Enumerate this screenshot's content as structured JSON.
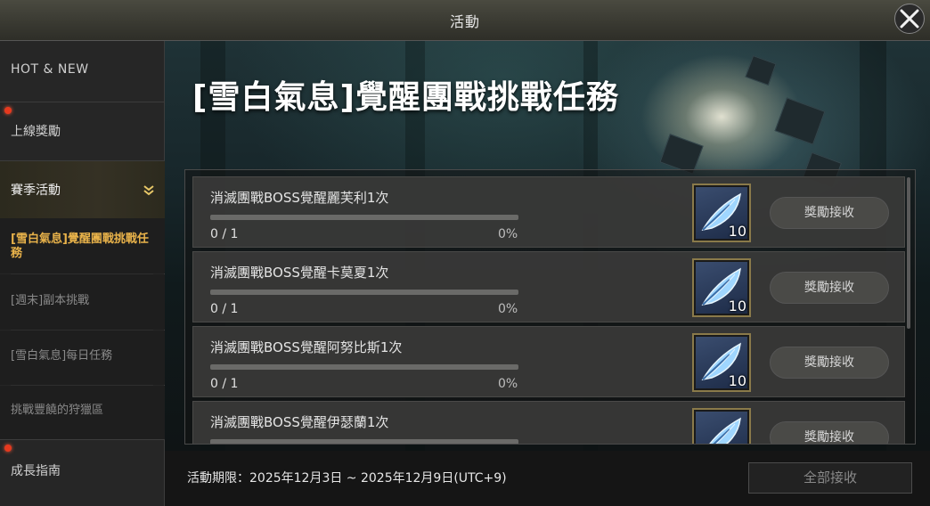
{
  "window": {
    "title": "活動"
  },
  "sidebar": {
    "items": [
      {
        "label": "HOT & NEW",
        "has_dot": false
      },
      {
        "label": "上線獎勵",
        "has_dot": true
      },
      {
        "label": "賽季活動",
        "has_dot": false,
        "expanded": true
      },
      {
        "label": "成長指南",
        "has_dot": true
      }
    ],
    "sub_items": [
      {
        "label": "[雪白氣息]覺醒團戰挑戰任務",
        "selected": true
      },
      {
        "label": "[週末]副本挑戰",
        "selected": false
      },
      {
        "label": "[雪白氣息]每日任務",
        "selected": false
      },
      {
        "label": "挑戰豐饒的狩獵區",
        "selected": false
      }
    ]
  },
  "main": {
    "event_title": "[雪白氣息]覺醒團戰挑戰任務",
    "tasks": [
      {
        "name": "消滅團戰BOSS覺醒麗芙利1次",
        "count": "0 / 1",
        "percent": "0%",
        "progress": 0,
        "reward_icon": "blue-feather-icon",
        "reward_qty": "10",
        "claim_label": "獎勵接收"
      },
      {
        "name": "消滅團戰BOSS覺醒卡莫夏1次",
        "count": "0 / 1",
        "percent": "0%",
        "progress": 0,
        "reward_icon": "blue-feather-icon",
        "reward_qty": "10",
        "claim_label": "獎勵接收"
      },
      {
        "name": "消滅團戰BOSS覺醒阿努比斯1次",
        "count": "0 / 1",
        "percent": "0%",
        "progress": 0,
        "reward_icon": "blue-feather-icon",
        "reward_qty": "10",
        "claim_label": "獎勵接收"
      },
      {
        "name": "消滅團戰BOSS覺醒伊瑟蘭1次",
        "count": "",
        "percent": "",
        "progress": 0,
        "reward_icon": "blue-feather-icon",
        "reward_qty": "",
        "claim_label": "獎勵接收"
      }
    ],
    "period_text": "活動期限：2025年12月3日 ~ 2025年12月9日(UTC+9)",
    "claim_all_label": "全部接收"
  },
  "colors": {
    "accent_gold": "#e8b24a",
    "notification_dot": "#e6391e",
    "progress_track": "#6a6a68"
  }
}
